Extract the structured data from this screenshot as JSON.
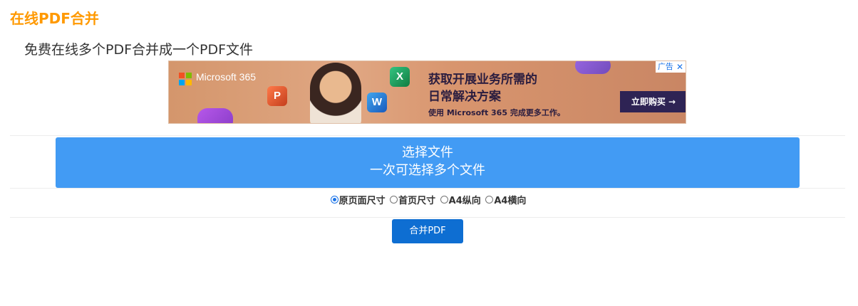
{
  "page": {
    "title": "在线PDF合并",
    "subtitle": "免费在线多个PDF合并成一个PDF文件"
  },
  "ad": {
    "brand": "Microsoft 365",
    "headline_line1": "获取开展业务所需的",
    "headline_line2": "日常解决方案",
    "subtext": "使用 Microsoft 365 完成更多工作。",
    "cta": "立即购买 →",
    "badge": "广告",
    "close": "✕",
    "icons": [
      "powerpoint-icon",
      "excel-icon",
      "word-icon"
    ]
  },
  "file_select": {
    "line1": "选择文件",
    "line2": "一次可选择多个文件"
  },
  "page_size_options": [
    {
      "label": "原页面尺寸",
      "checked": true
    },
    {
      "label": "首页尺寸",
      "checked": false
    },
    {
      "label": "A4纵向",
      "checked": false
    },
    {
      "label": "A4横向",
      "checked": false
    }
  ],
  "merge_button": "合并PDF",
  "colors": {
    "title": "#ff9900",
    "select_button": "#429bf4",
    "merge_button": "#0e6ed2"
  }
}
